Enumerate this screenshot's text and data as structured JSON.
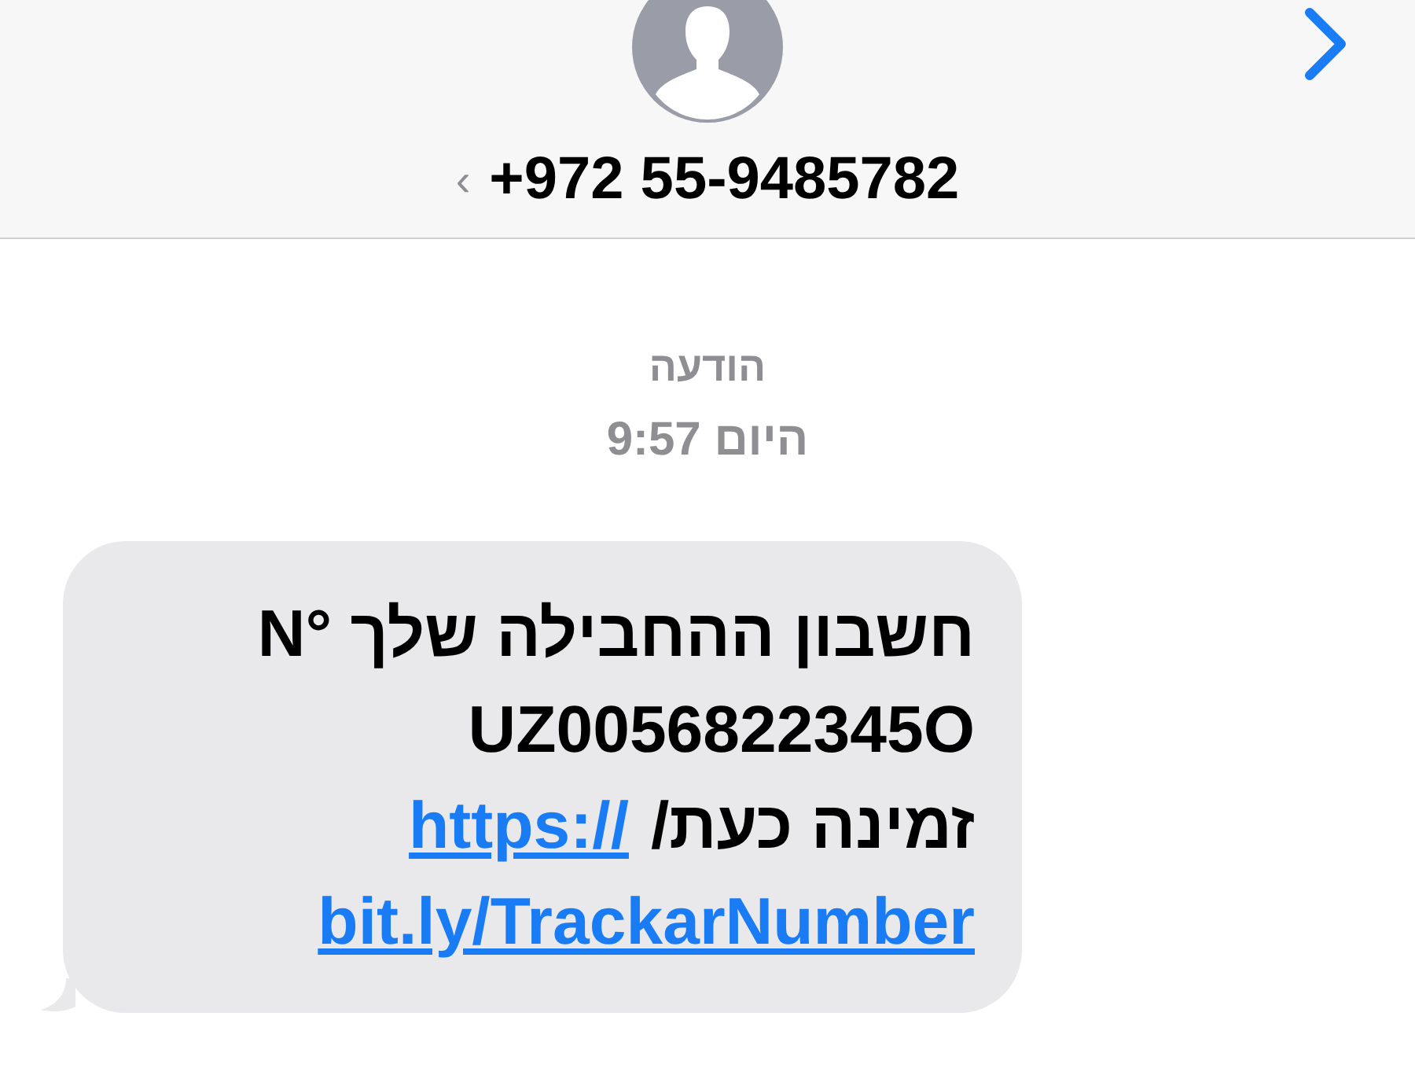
{
  "header": {
    "back": "‹",
    "contact": "+972 55-9485782"
  },
  "timestamp": {
    "label": "הודעה",
    "time": "היום 9:57"
  },
  "message": {
    "lines": [
      "חשבון ההחבילה שלך N°‎",
      "UZ0056822345O"
    ],
    "text_before_link": "זמינה כעת/",
    "link_parts": [
      "https://",
      "bit.ly/TrackarNumber"
    ]
  }
}
